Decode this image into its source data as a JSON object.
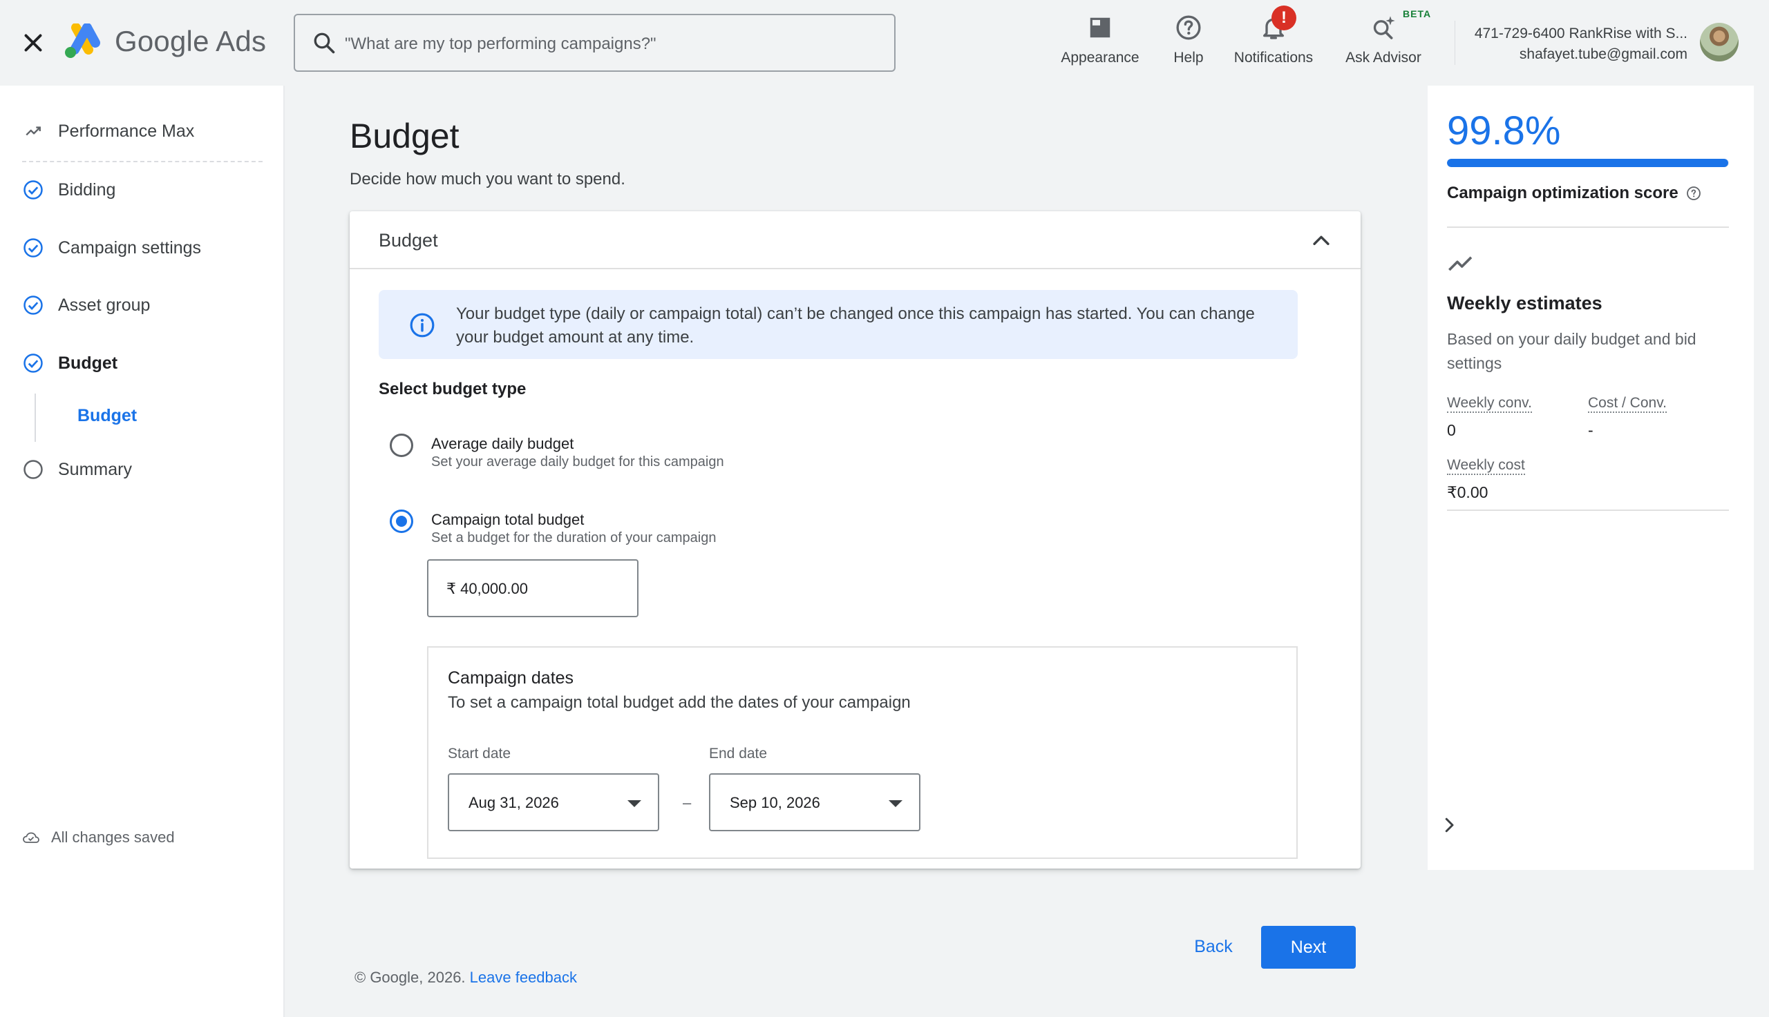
{
  "header": {
    "brand": "Google Ads",
    "search_placeholder": "\"What are my top performing campaigns?\"",
    "tools": {
      "appearance": "Appearance",
      "help": "Help",
      "notifications": "Notifications",
      "notifications_badge": "!",
      "ask_advisor": "Ask Advisor",
      "beta": "BETA"
    },
    "account_name": "471-729-6400 RankRise with S...",
    "account_email": "shafayet.tube@gmail.com"
  },
  "sidebar": {
    "campaign_type": "Performance Max",
    "items": [
      {
        "label": "Bidding",
        "state": "done"
      },
      {
        "label": "Campaign settings",
        "state": "done"
      },
      {
        "label": "Asset group",
        "state": "done"
      },
      {
        "label": "Budget",
        "state": "current"
      },
      {
        "label": "Summary",
        "state": "todo"
      }
    ],
    "sub_item": "Budget",
    "saved_status": "All changes saved"
  },
  "main": {
    "title": "Budget",
    "subtitle": "Decide how much you want to spend.",
    "card": {
      "title": "Budget",
      "info": "Your budget type (daily or campaign total) can’t be changed once this campaign has started. You can change your budget amount at any time.",
      "select_label": "Select budget type",
      "options": [
        {
          "title": "Average daily budget",
          "desc": "Set your average daily budget for this campaign",
          "selected": false
        },
        {
          "title": "Campaign total budget",
          "desc": "Set a budget for the duration of your campaign",
          "selected": true
        }
      ],
      "amount": "₹ 40,000.00",
      "dates": {
        "title": "Campaign dates",
        "desc": "To set a campaign total budget add the dates of your campaign",
        "start_label": "Start date",
        "start_value": "Aug 31, 2026",
        "separator": "–",
        "end_label": "End date",
        "end_value": "Sep 10, 2026"
      }
    },
    "buttons": {
      "back": "Back",
      "next": "Next"
    },
    "footer": {
      "copyright": "© Google, 2026.",
      "feedback": "Leave feedback"
    }
  },
  "right_panel": {
    "score": "99.8%",
    "score_fraction": 0.998,
    "score_label": "Campaign optimization score",
    "weekly_title": "Weekly estimates",
    "weekly_sub": "Based on your daily budget and bid settings",
    "metrics": {
      "weekly_conv_label": "Weekly conv.",
      "weekly_conv_value": "0",
      "cost_conv_label": "Cost / Conv.",
      "cost_conv_value": "-",
      "weekly_cost_label": "Weekly cost",
      "weekly_cost_value": "₹0.00"
    }
  },
  "colors": {
    "accent": "#1a73e8",
    "background": "#f1f3f4",
    "info_bg": "#e8f0fe",
    "alert": "#d93025"
  }
}
